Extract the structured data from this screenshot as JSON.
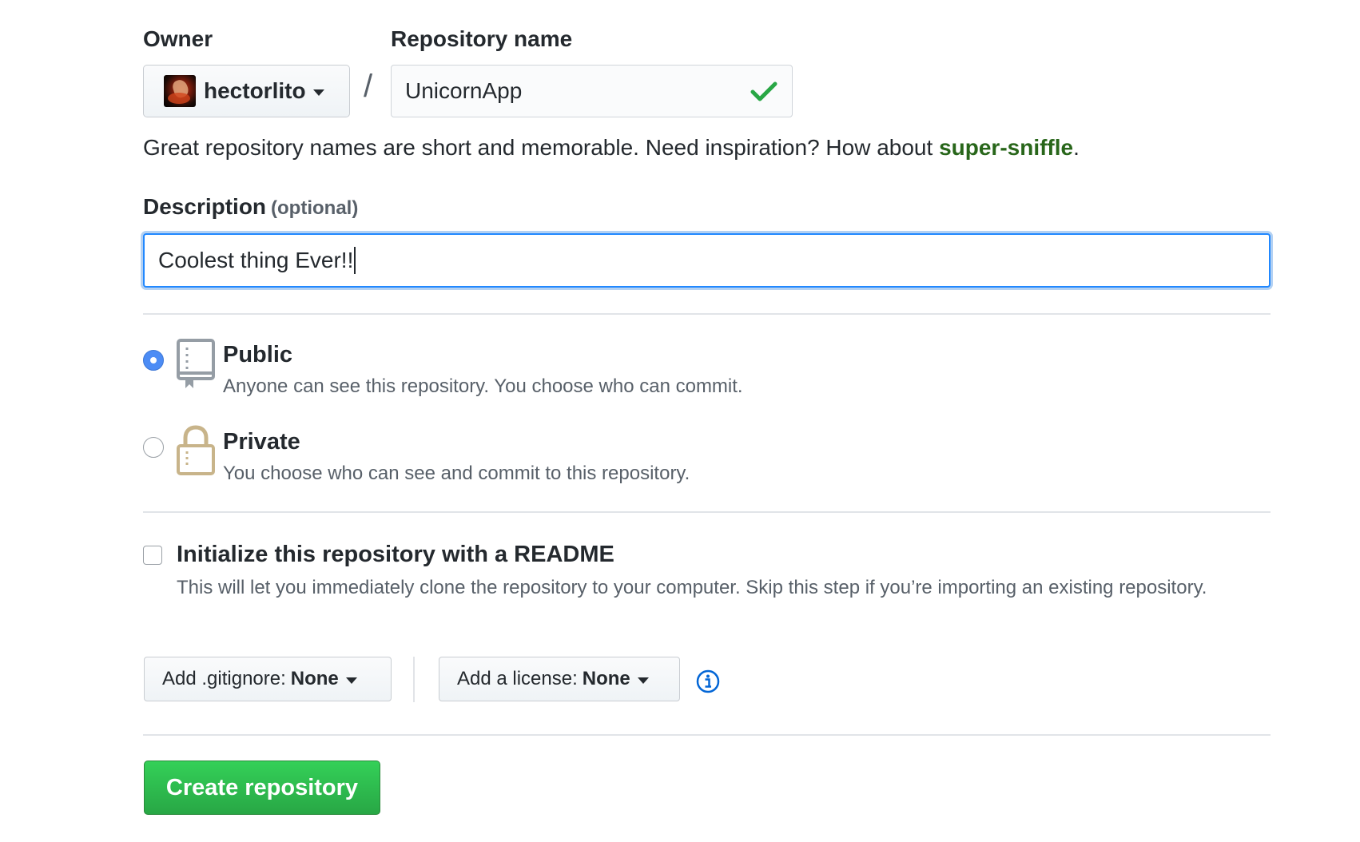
{
  "owner": {
    "label": "Owner",
    "name": "hectorlito",
    "avatar_icon": "user-avatar"
  },
  "repository": {
    "label": "Repository name",
    "separator": "/",
    "value": "UnicornApp",
    "valid_icon": "check-icon",
    "valid_color": "#28a745"
  },
  "hint": {
    "text": "Great repository names are short and memorable. Need inspiration? How about ",
    "suggestion": "super-sniffle",
    "suffix": "."
  },
  "description": {
    "label": "Description",
    "optional": "(optional)",
    "value": "Coolest thing Ever!!"
  },
  "visibility": {
    "selected": "public",
    "options": [
      {
        "id": "public",
        "title": "Public",
        "description": "Anyone can see this repository. You choose who can commit.",
        "icon": "repo-icon"
      },
      {
        "id": "private",
        "title": "Private",
        "description": "You choose who can see and commit to this repository.",
        "icon": "lock-icon"
      }
    ]
  },
  "readme": {
    "checked": false,
    "title": "Initialize this repository with a README",
    "description": "This will let you immediately clone the repository to your computer. Skip this step if you’re importing an existing repository."
  },
  "gitignore": {
    "label": "Add .gitignore:",
    "value": "None"
  },
  "license": {
    "label": "Add a license:",
    "value": "None",
    "info_icon": "info-icon"
  },
  "submit": {
    "label": "Create repository",
    "color": "#28a745"
  }
}
